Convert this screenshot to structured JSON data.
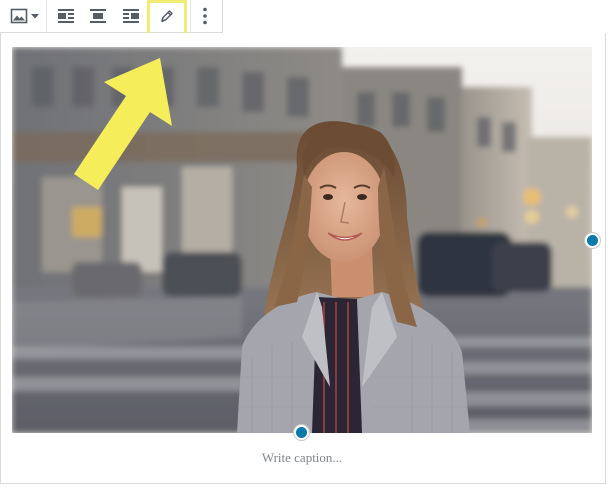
{
  "toolbar": {
    "items": [
      {
        "name": "image-block-type-button",
        "icon": "image-icon",
        "has_dropdown": true
      },
      {
        "name": "align-left-button",
        "icon": "align-left-icon"
      },
      {
        "name": "align-center-button",
        "icon": "align-center-icon"
      },
      {
        "name": "align-right-button",
        "icon": "align-right-icon"
      },
      {
        "name": "edit-image-button",
        "icon": "pencil-icon",
        "highlighted": true
      },
      {
        "name": "more-options-button",
        "icon": "vertical-ellipsis-icon"
      }
    ]
  },
  "image": {
    "subject": "photo-woman-in-grey-blazer-on-city-street",
    "resize_handles": [
      "right",
      "bottom"
    ]
  },
  "caption": {
    "placeholder": "Write caption..."
  },
  "annotation": {
    "arrow_color": "#f5ee5a",
    "highlight_color": "#f1ec72",
    "points_to": "edit-image-button"
  },
  "colors": {
    "handle": "#0a7aad",
    "border": "#d8dadd",
    "icon": "#555d66",
    "caption_text": "#7f858b"
  }
}
